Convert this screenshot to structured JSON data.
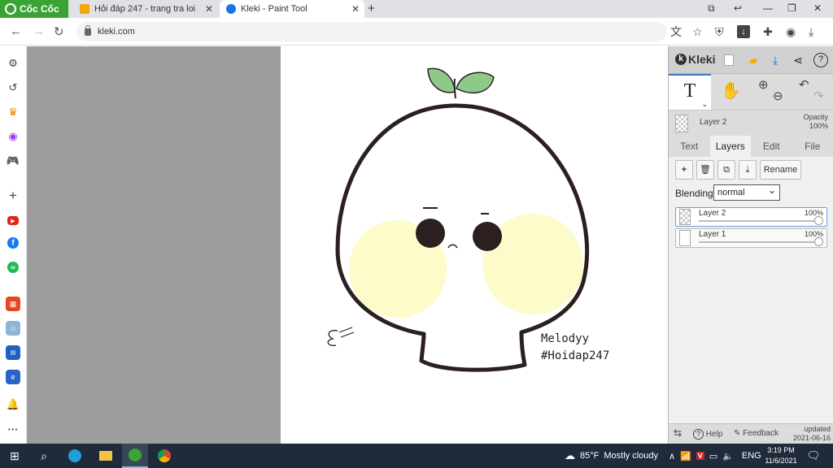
{
  "browser": {
    "brand": "Cốc Cốc",
    "tabs": [
      {
        "title": "Hỏi đáp 247 - trang tra loi",
        "fav_color": "#f2a60c"
      },
      {
        "title": "Kleki - Paint Tool",
        "fav_color": "#1a73e8"
      }
    ],
    "new_tab": "+",
    "address": "kleki.com"
  },
  "sidebar_icons": [
    "settings-icon",
    "history-icon",
    "crown-icon",
    "messenger-icon",
    "game-icon",
    "add-icon",
    "youtube-icon",
    "facebook-icon",
    "spotify-icon",
    "shop-icon",
    "anime-icon",
    "sale-1111-icon",
    "app-icon",
    "bell-icon",
    "more-icon"
  ],
  "canvas": {
    "signature_line1": "Melodyy",
    "signature_line2": "#Hoidap247"
  },
  "kleki": {
    "logo": "Kleki",
    "tool_letter": "T",
    "layer_name": "Layer 2",
    "opacity_label": "Opacity",
    "opacity_value": "100%",
    "tabs": [
      "Text",
      "Layers",
      "Edit",
      "File"
    ],
    "active_tab": "Layers",
    "rename": "Rename",
    "blending_label": "Blending",
    "blending_value": "normal",
    "layers": [
      {
        "name": "Layer 2",
        "opacity": "100%",
        "selected": true
      },
      {
        "name": "Layer 1",
        "opacity": "100%",
        "selected": false
      }
    ],
    "footer": {
      "help": "Help",
      "feedback": "Feedback",
      "updated": "updated",
      "date": "2021-06-16"
    }
  },
  "taskbar": {
    "temperature": "85°F",
    "weather": "Mostly cloudy",
    "lang": "ENG",
    "time": "3:19 PM",
    "date": "11/6/2021"
  }
}
